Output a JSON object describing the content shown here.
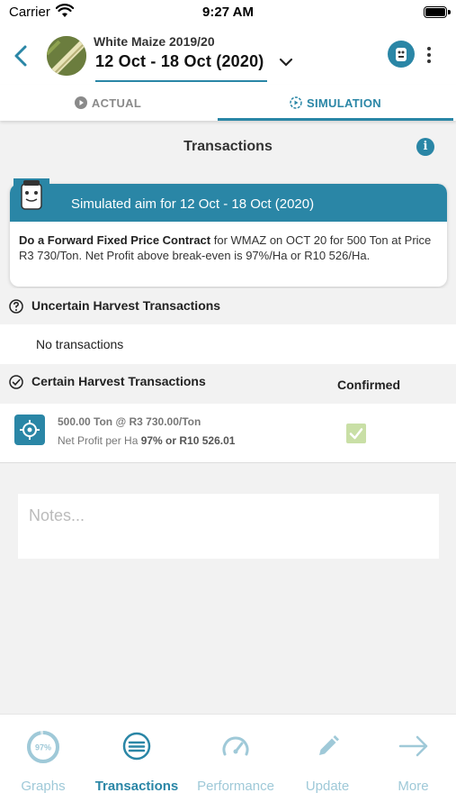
{
  "status_bar": {
    "carrier": "Carrier",
    "time": "9:27 AM"
  },
  "header": {
    "crop_name": "White Maize 2019/20",
    "date_range": "12 Oct - 18 Oct (2020)"
  },
  "tabs": [
    {
      "label": "ACTUAL",
      "active": false
    },
    {
      "label": "SIMULATION",
      "active": true
    }
  ],
  "section_title": "Transactions",
  "aim_card": {
    "title": "Simulated aim for 12 Oct - 18 Oct (2020)",
    "action": "Do a Forward Fixed Price Contract",
    "detail": " for WMAZ on OCT 20 for 500 Ton at Price R3 730/Ton. Net Profit above break-even is 97%/Ha or R10 526/Ha."
  },
  "uncertain": {
    "heading": "Uncertain Harvest Transactions",
    "empty_text": "No transactions"
  },
  "certain": {
    "heading": "Certain Harvest Transactions",
    "confirmed_label": "Confirmed",
    "rows": [
      {
        "summary": "500.00 Ton @ R3 730.00/Ton",
        "profit_label": "Net Profit per Ha ",
        "profit_value": "97% or R10 526.01",
        "confirmed": true
      }
    ]
  },
  "notes": {
    "placeholder": "Notes..."
  },
  "bottom_nav": {
    "graphs_badge": "97%",
    "items": [
      {
        "label": "Graphs",
        "icon": "progress-ring-icon",
        "active": false
      },
      {
        "label": "Transactions",
        "icon": "list-circle-icon",
        "active": true
      },
      {
        "label": "Performance",
        "icon": "gauge-icon",
        "active": false
      },
      {
        "label": "Update",
        "icon": "pencil-icon",
        "active": false
      },
      {
        "label": "More",
        "icon": "arrow-right-icon",
        "active": false
      }
    ]
  },
  "colors": {
    "accent": "#2a86a6",
    "inactive_nav": "#9fc9d8",
    "confirm_check": "#c9dfa6"
  }
}
